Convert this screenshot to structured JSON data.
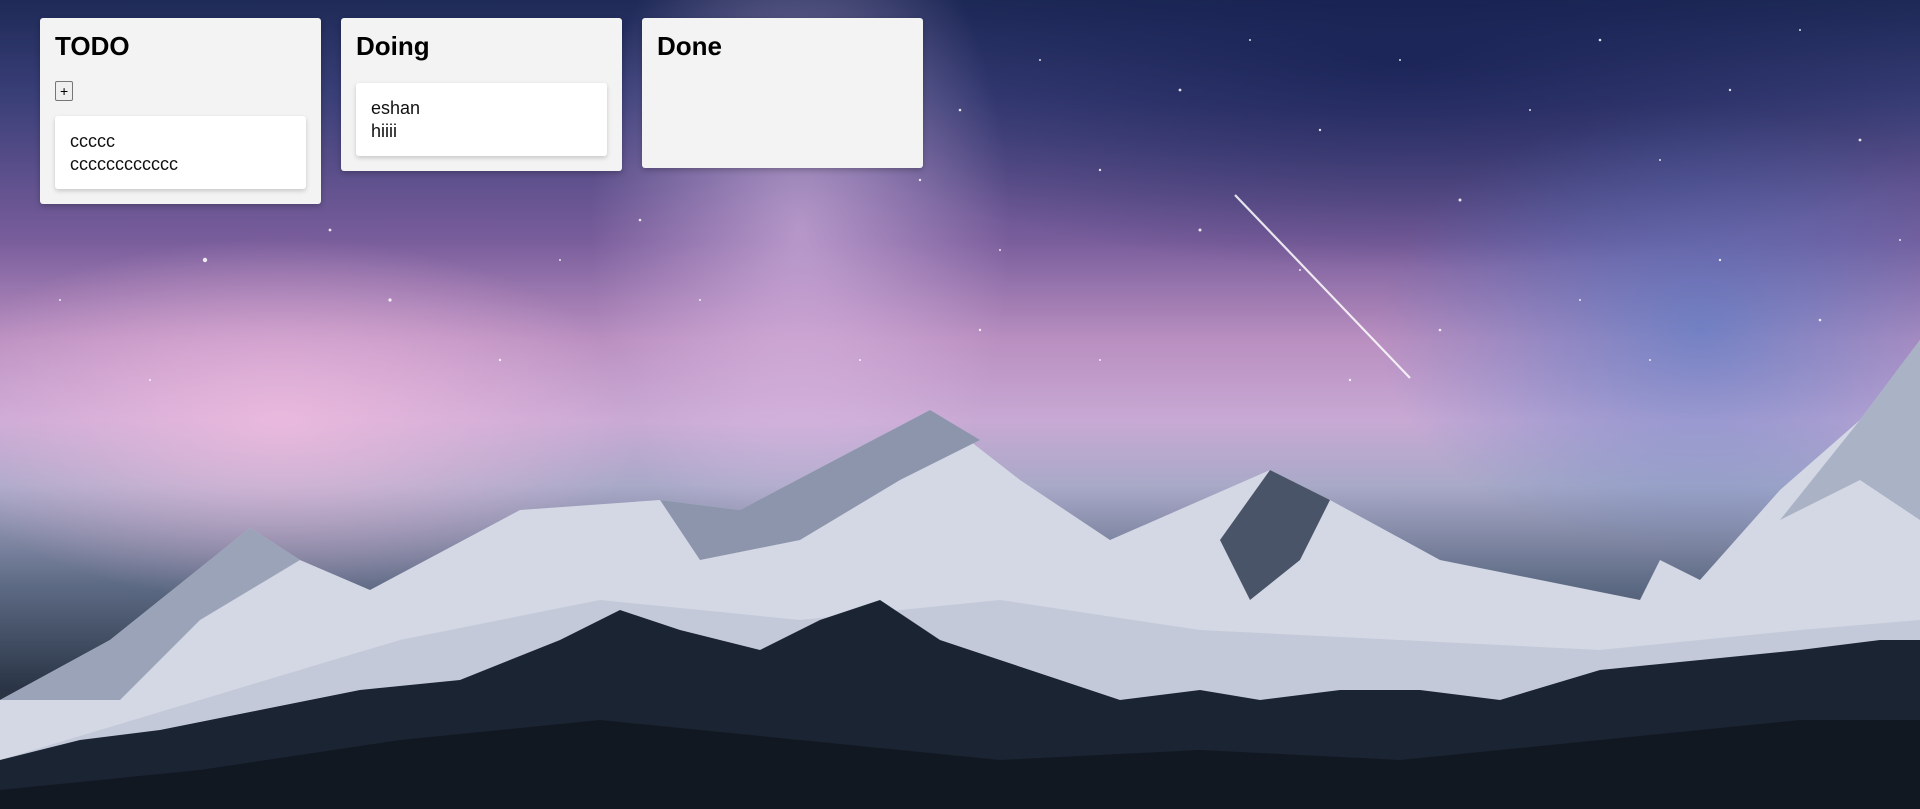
{
  "board": {
    "columns": [
      {
        "title": "TODO",
        "add_label": "+",
        "cards": [
          {
            "title": "ccccc",
            "description": "cccccccccccc"
          }
        ]
      },
      {
        "title": "Doing",
        "cards": [
          {
            "title": "eshan",
            "description": "hiiii"
          }
        ]
      },
      {
        "title": "Done",
        "cards": []
      }
    ]
  },
  "theme": {
    "column_bg": "#f3f3f3",
    "card_bg": "#ffffff",
    "text": "#000000"
  },
  "background": {
    "description_icon": "mountain-night-sky-image"
  }
}
